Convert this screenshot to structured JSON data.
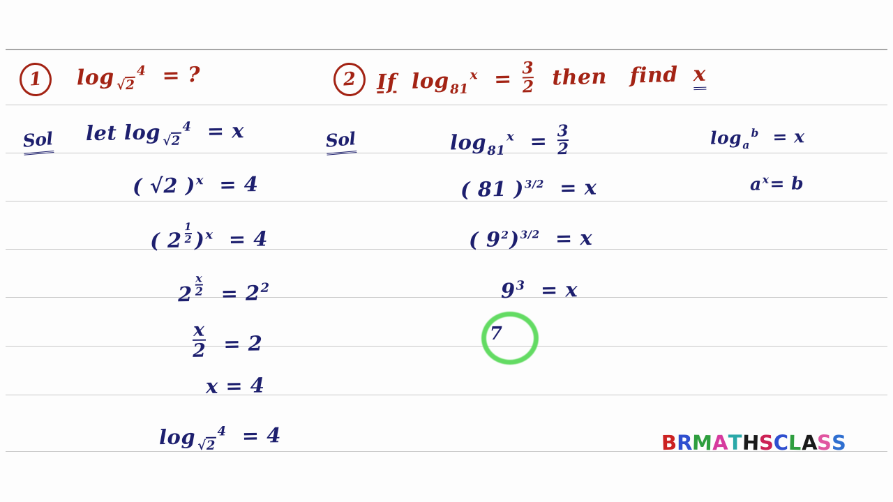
{
  "board": {
    "background_color": "#fdfdfd",
    "rule_color": "#c8c8c8",
    "ink_blue": "#1d1f6e",
    "ink_red": "#a32314",
    "highlight_green": "#57d957",
    "rule_positions": [
      70,
      150,
      219,
      288,
      357,
      426,
      496,
      566,
      647
    ]
  },
  "problem1": {
    "number": "1",
    "question": {
      "log_word": "log",
      "base": "2",
      "radical": "√",
      "argument": "4",
      "equals": "=",
      "result": "?"
    },
    "solution_label": "Sol",
    "steps": [
      {
        "id": "step-let",
        "text": "let  log",
        "base": "2",
        "arg": "4",
        "rhs": "= x"
      },
      {
        "id": "step-sqrt-pow",
        "text": "( √2 )",
        "exponent": "x",
        "rhs": "= 4"
      },
      {
        "id": "step-half-pow",
        "text": "( 2",
        "exponent_frac": "1/2",
        "close": ")",
        "exponent": "x",
        "rhs": "= 4"
      },
      {
        "id": "step-base2",
        "text": "2",
        "exponent_frac": "x/2",
        "rhs": "= 2",
        "rhs_exponent": "2"
      },
      {
        "id": "step-frac-eq",
        "frac": "x/2",
        "rhs": "= 2"
      },
      {
        "id": "step-x-value",
        "text": "x = 4"
      },
      {
        "id": "step-final",
        "text": "log",
        "base": "2",
        "arg": "4",
        "rhs": "= 4"
      }
    ]
  },
  "problem2": {
    "number": "2",
    "question": {
      "if_word": "If",
      "log_word": "log",
      "base": "81",
      "argument": "x",
      "equals": "=",
      "fraction_num": "3",
      "fraction_den": "2",
      "then_word": "then",
      "find_word": "find",
      "unknown": "x"
    },
    "solution_label": "Sol",
    "steps": [
      {
        "id": "step2-given",
        "text": "log",
        "base": "81",
        "arg": "x",
        "rhs": "=",
        "frac": "3/2"
      },
      {
        "id": "step2-power",
        "text": "( 81 )",
        "exponent": "3/2",
        "rhs": "= x"
      },
      {
        "id": "step2-nine",
        "text": "( 9",
        "inner_exponent": "2",
        "close": ")",
        "exponent": "3/2",
        "rhs": "= x"
      },
      {
        "id": "step2-cube",
        "text": "9",
        "exponent": "3",
        "rhs": "= x"
      },
      {
        "id": "step2-answer",
        "text": "7",
        "circled": true
      }
    ]
  },
  "reference": {
    "line1": {
      "log_word": "log",
      "base": "a",
      "arg": "b",
      "rhs": "= x"
    },
    "line2": {
      "text": "a",
      "exponent": "x",
      "rhs": "= b"
    }
  },
  "logo": {
    "text": "BRMATHSCLASS",
    "letters": [
      {
        "char": "B",
        "color": "#cc2222"
      },
      {
        "char": "R",
        "color": "#2f4fcf"
      },
      {
        "char": "M",
        "color": "#2e9e3e"
      },
      {
        "char": "A",
        "color": "#d63a9e"
      },
      {
        "char": "T",
        "color": "#2aa8a8"
      },
      {
        "char": "H",
        "color": "#1a1a1a"
      },
      {
        "char": "S",
        "color": "#cc2255"
      },
      {
        "char": "C",
        "color": "#2f4fcf"
      },
      {
        "char": "L",
        "color": "#2e9e3e"
      },
      {
        "char": "A",
        "color": "#1a1a1a"
      },
      {
        "char": "S",
        "color": "#e055a0"
      },
      {
        "char": "S",
        "color": "#2f6fd0"
      }
    ]
  }
}
